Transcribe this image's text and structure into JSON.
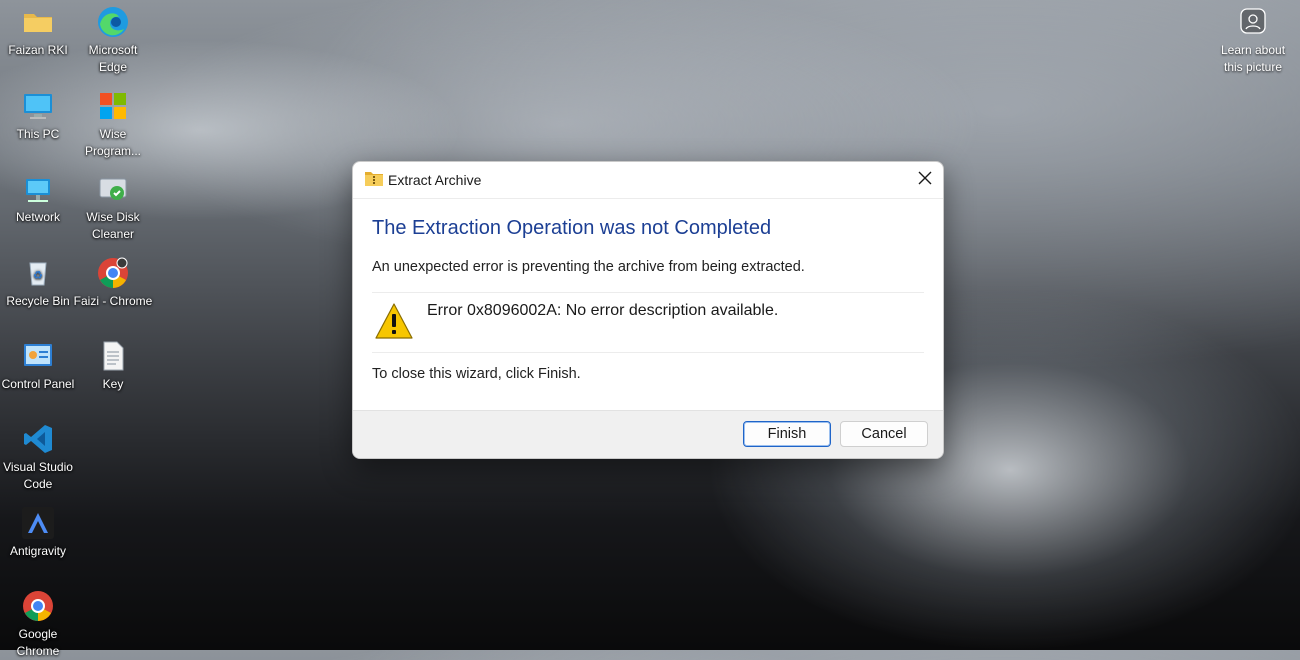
{
  "desktop": {
    "icons": [
      {
        "label": "Faizan RKI"
      },
      {
        "label": "Microsoft Edge"
      },
      {
        "label": "This PC"
      },
      {
        "label": "Wise Program..."
      },
      {
        "label": "Network"
      },
      {
        "label": "Wise Disk Cleaner"
      },
      {
        "label": "Recycle Bin"
      },
      {
        "label": "Faizi - Chrome"
      },
      {
        "label": "Control Panel"
      },
      {
        "label": "Key"
      },
      {
        "label": "Visual Studio Code"
      },
      {
        "label": "Antigravity"
      },
      {
        "label": "Google Chrome"
      }
    ],
    "learn_about": "Learn about this picture"
  },
  "dialog": {
    "title": "Extract Archive",
    "heading": "The Extraction Operation was not Completed",
    "subtitle": "An unexpected error is preventing the archive from being extracted.",
    "error_message": "Error 0x8096002A: No error description available.",
    "close_hint": "To close this wizard, click Finish.",
    "finish_label": "Finish",
    "cancel_label": "Cancel"
  },
  "colors": {
    "heading": "#1c3f94",
    "primary_border": "#1f64c8",
    "warning": "#f7c600"
  }
}
